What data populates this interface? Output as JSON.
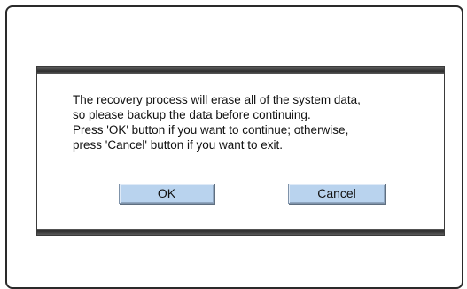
{
  "dialog": {
    "message_lines": [
      "The recovery process will erase all of the system data,",
      "so please backup the data before continuing.",
      "Press 'OK' button if you want to continue; otherwise,",
      "press 'Cancel' button if you want to exit."
    ],
    "ok_label": "OK",
    "cancel_label": "Cancel"
  },
  "colors": {
    "button_face": "#b9d3ee",
    "dialog_bar": "#3a3a3a"
  }
}
